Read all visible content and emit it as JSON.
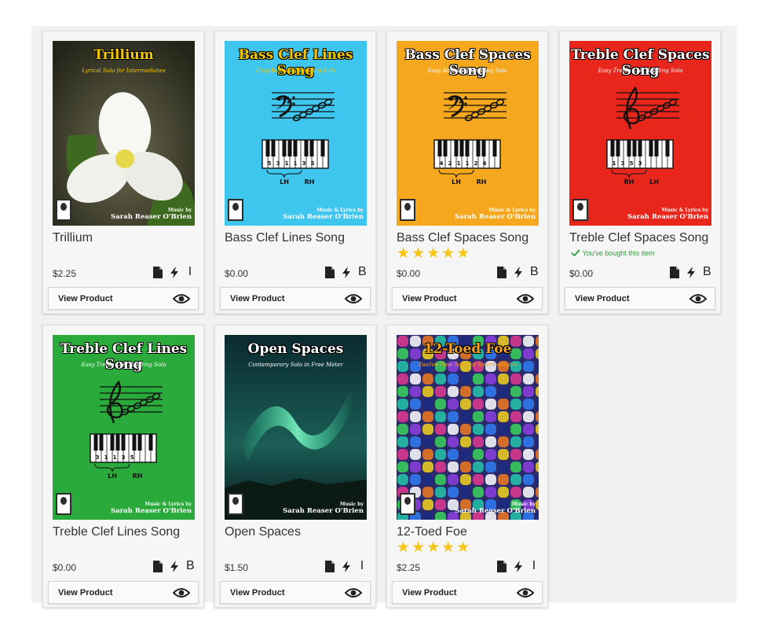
{
  "view_label": "View Product",
  "bought_label": "You've bought this item",
  "icons": {
    "file": "file-icon",
    "instant": "lightning-icon",
    "view": "eye-icon",
    "check": "check-icon",
    "star": "star-icon"
  },
  "colors": {
    "star": "#f5c518",
    "bought": "#2e9b3a",
    "card_bg": "#f6f6f6"
  },
  "products": [
    {
      "title": "Trillium",
      "price": "$2.25",
      "level": "I",
      "rating": 0,
      "bought": false,
      "cover": {
        "title": "Trillium",
        "subtitle": "Lyrical Solo for Intermediates",
        "credit_label": "Music by",
        "credit_name": "Sarah Reaser O'Brien",
        "style": "photo-flower",
        "bg": "#3b3a2a",
        "title_color": "#f6c800"
      }
    },
    {
      "title": "Bass Clef Lines Song",
      "price": "$0.00",
      "level": "B",
      "rating": 0,
      "bought": false,
      "cover": {
        "title": "Bass Clef Lines Song",
        "subtitle": "Easy Bass Clef Reading Solo",
        "credit_label": "Music & Lyrics by",
        "credit_name": "Sarah Reaser O'Brien",
        "style": "staff-bass",
        "bg": "#3fc6ef",
        "title_color": "#f6c800",
        "hand_labels": [
          "LH",
          "RH"
        ],
        "finger_numbers": [
          "5",
          "3",
          "1",
          "1",
          "3",
          "5"
        ]
      }
    },
    {
      "title": "Bass Clef Spaces Song",
      "price": "$0.00",
      "level": "B",
      "rating": 5,
      "bought": false,
      "cover": {
        "title": "Bass Clef Spaces Song",
        "subtitle": "Easy Bass Clef Reading Solo",
        "credit_label": "Music & Lyrics by",
        "credit_name": "Sarah Reaser O'Brien",
        "style": "staff-bass",
        "bg": "#f5a71d",
        "title_color": "#ffffff",
        "hand_labels": [
          "LH",
          "RH"
        ],
        "finger_numbers": [
          "4",
          "2",
          "1",
          "1",
          "2",
          "4"
        ]
      }
    },
    {
      "title": "Treble Clef Spaces Song",
      "price": "$0.00",
      "level": "B",
      "rating": 0,
      "bought": true,
      "cover": {
        "title": "Treble Clef Spaces Song",
        "subtitle": "Easy Treble Clef Reading Solo",
        "credit_label": "Music & Lyrics by",
        "credit_name": "Sarah Reaser O'Brien",
        "style": "staff-treble",
        "bg": "#e8261c",
        "title_color": "#ffffff",
        "hand_labels": [
          "RH",
          "LH"
        ],
        "finger_numbers": [
          "1",
          "3",
          "5",
          "3"
        ]
      }
    },
    {
      "title": "Treble Clef Lines Song",
      "price": "$0.00",
      "level": "B",
      "rating": 0,
      "bought": false,
      "cover": {
        "title": "Treble Clef Lines Song",
        "subtitle": "Easy Treble Clef Reading Solo",
        "credit_label": "Music & Lyrics by",
        "credit_name": "Sarah Reaser O'Brien",
        "style": "staff-treble",
        "bg": "#2aaa3a",
        "title_color": "#ffffff",
        "hand_labels": [
          "LH",
          "RH"
        ],
        "finger_numbers": [
          "3",
          "1",
          "1",
          "3",
          "5"
        ]
      }
    },
    {
      "title": "Open Spaces",
      "price": "$1.50",
      "level": "I",
      "rating": 0,
      "bought": false,
      "cover": {
        "title": "Open Spaces",
        "subtitle": "Contemporary Solo in Free Meter",
        "credit_label": "Music by",
        "credit_name": "Sarah Reaser O'Brien",
        "style": "aurora",
        "bg": "#0e3b3f",
        "title_color": "#ffffff"
      }
    },
    {
      "title": "12-Toed Foe",
      "price": "$2.25",
      "level": "I",
      "rating": 5,
      "bought": false,
      "cover": {
        "title": "12-Toed Foe",
        "subtitle": "Twelve-Tone Solo for Intermediates",
        "credit_label": "Music by",
        "credit_name": "Sarah Reaser O'Brien",
        "style": "mosaic",
        "bg": "#2a2a6a",
        "title_color": "#f5a21d"
      }
    }
  ]
}
